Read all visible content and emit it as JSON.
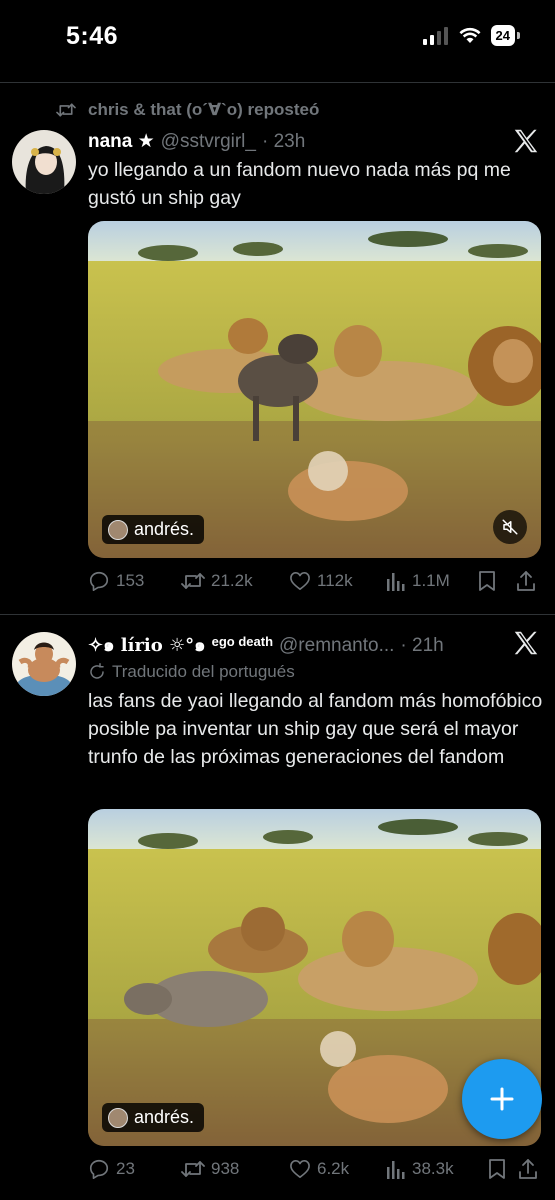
{
  "status_bar": {
    "time": "5:46",
    "battery": "24"
  },
  "repost": {
    "text": "chris & that (o´∀`o) reposteó"
  },
  "tweets": [
    {
      "name": "nana ★",
      "handle": "@sstvrgirl_",
      "time": "· 23h",
      "text": "yo llegando a un fandom nuevo nada más pq me gustó un ship gay",
      "media_tag": "andrés.",
      "replies": "153",
      "reposts": "21.2k",
      "likes": "112k",
      "views": "1.1M"
    },
    {
      "name": "✧๑ lírio ☼°๑",
      "name_suffix": "ego death",
      "handle": "@remnanto...",
      "time": "· 21h",
      "translated": "Traducido del portugués",
      "text": "las fans de yaoi llegando al fandom más homofóbico posible pa inventar un ship gay que será el mayor trunfo de las próximas generaciones del fandom",
      "media_tag": "andrés.",
      "replies": "23",
      "reposts": "938",
      "likes": "6.2k",
      "views": "38.3k"
    }
  ],
  "colors": {
    "accent": "#1d9bf0",
    "secondary_text": "#71767b",
    "divider": "#2f3336"
  }
}
